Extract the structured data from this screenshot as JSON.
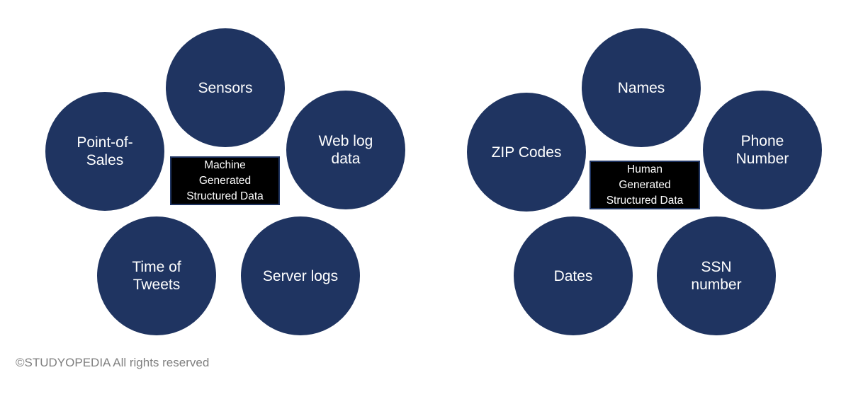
{
  "colors": {
    "circle": "#1f3461",
    "box": "#000000",
    "text": "#ffffff",
    "footer": "#7f7f7f"
  },
  "machine": {
    "center_label": "Machine\nGenerated\nStructured Data",
    "items": [
      "Sensors",
      "Point-of-\nSales",
      "Web log\ndata",
      "Time of\nTweets",
      "Server logs"
    ]
  },
  "human": {
    "center_label": "Human\nGenerated\nStructured Data",
    "items": [
      "Names",
      "ZIP Codes",
      "Phone\nNumber",
      "Dates",
      "SSN\nnumber"
    ]
  },
  "footer": "©STUDYOPEDIA  All rights reserved"
}
